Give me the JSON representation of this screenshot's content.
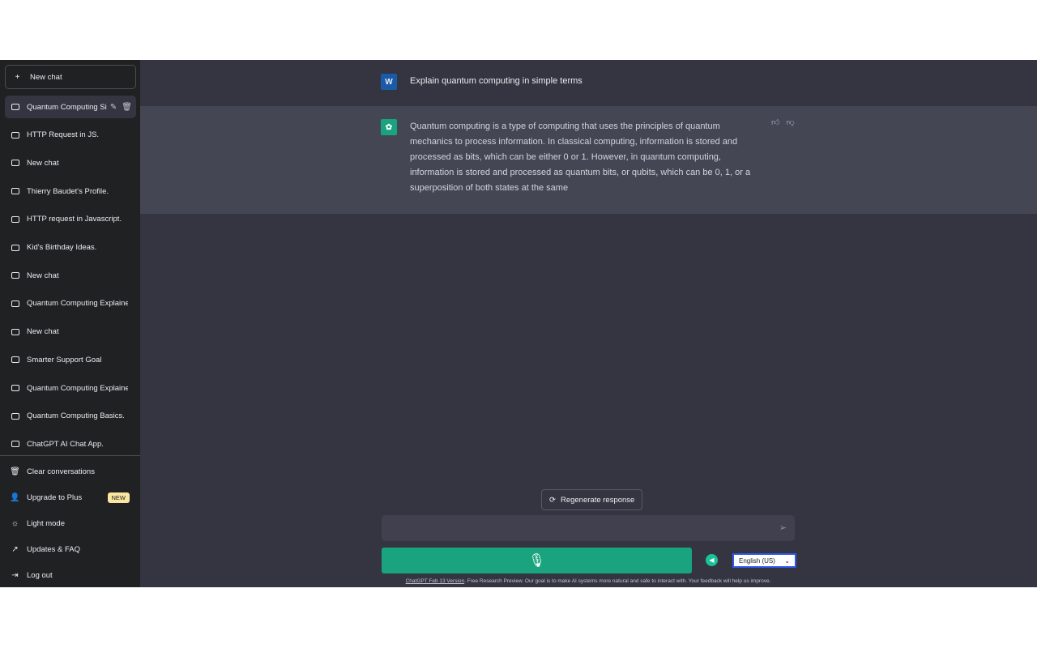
{
  "sidebar": {
    "new_chat": "New chat",
    "chats": [
      "Quantum Computing Si",
      "HTTP Request in JS.",
      "New chat",
      "Thierry Baudet's Profile.",
      "HTTP request in Javascript.",
      "Kid's Birthday Ideas.",
      "New chat",
      "Quantum Computing Explaine",
      "New chat",
      "Smarter Support Goal",
      "Quantum Computing Explaine",
      "Quantum Computing Basics.",
      "ChatGPT AI Chat App."
    ],
    "bottom": {
      "clear": "Clear conversations",
      "upgrade": "Upgrade to Plus",
      "new_badge": "NEW",
      "light": "Light mode",
      "updates": "Updates & FAQ",
      "logout": "Log out"
    }
  },
  "conversation": {
    "user_initial": "W",
    "user_message": "Explain quantum computing in simple terms",
    "assistant_message": "Quantum computing is a type of computing that uses the principles of quantum mechanics to process information. In classical computing, information is stored and processed as bits, which can be either 0 or 1. However, in quantum computing, information is stored and processed as quantum bits, or qubits, which can be 0, 1, or a superposition of both states at the same"
  },
  "composer": {
    "regenerate": "Regenerate response",
    "input_value": "",
    "language": "English (US)"
  },
  "footer": {
    "link": "ChatGPT Feb 13 Version",
    "text": ". Free Research Preview. Our goal is to make AI systems more natural and safe to interact with. Your feedback will help us improve."
  },
  "colors": {
    "accent": "#19a37e",
    "user_avatar": "#1a5ba8",
    "assistant_avatar": "#19a37e"
  }
}
